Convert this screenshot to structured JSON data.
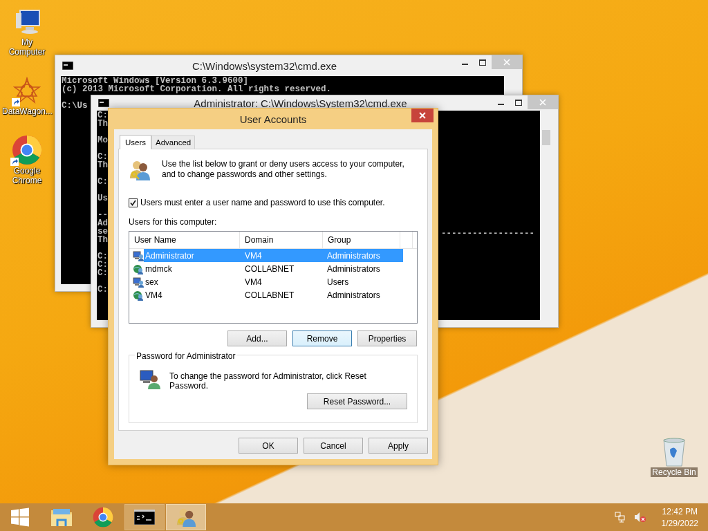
{
  "desktop_icons": [
    {
      "label": "My Computer",
      "kind": "computer",
      "shortcut": false
    },
    {
      "label": "DataWagon...",
      "kind": "star",
      "shortcut": true
    },
    {
      "label": "Google Chrome",
      "kind": "chrome",
      "shortcut": true
    }
  ],
  "recycle_bin": {
    "label": "Recycle Bin"
  },
  "back_console": {
    "title": "C:\\Windows\\system32\\cmd.exe",
    "blocks": [
      [
        "Microsoft Windows [Version 6.3.9600]",
        "(c) 2013 Microsoft Corporation. All rights reserved."
      ],
      [
        "C:\\Us"
      ]
    ]
  },
  "admin_console": {
    "title": "Administrator: C:\\Windows\\System32\\cmd.exe",
    "blocks": [
      [
        "C:",
        "Th"
      ],
      [
        "Mo"
      ],
      [
        "C:",
        "Th"
      ],
      [
        "C:"
      ],
      [
        "Us"
      ],
      [
        "--",
        "Ad",
        "se",
        "Th"
      ],
      [
        "C:",
        "C:",
        "C:"
      ],
      [
        "C:"
      ]
    ],
    "right_line": "------------------"
  },
  "dialog": {
    "title": "User Accounts",
    "tabs": [
      {
        "label": "Users",
        "selected": true
      },
      {
        "label": "Advanced",
        "selected": false
      }
    ],
    "intro": "Use the list below to grant or deny users access to your computer, and to change passwords and other settings.",
    "require_password": {
      "label": "Users must enter a user name and password to use this computer.",
      "checked": true
    },
    "list_label": "Users for this computer:",
    "columns": [
      "User Name",
      "Domain",
      "Group"
    ],
    "rows": [
      {
        "kind": "local",
        "name": "Administrator",
        "domain": "VM4",
        "group": "Administrators",
        "selected": true
      },
      {
        "kind": "domain",
        "name": "mdmck",
        "domain": "COLLABNET",
        "group": "Administrators",
        "selected": false
      },
      {
        "kind": "local",
        "name": "sex",
        "domain": "VM4",
        "group": "Users",
        "selected": false
      },
      {
        "kind": "domain",
        "name": "VM4",
        "domain": "COLLABNET",
        "group": "Administrators",
        "selected": false
      }
    ],
    "list_buttons": [
      {
        "label": "Add...",
        "focused": false
      },
      {
        "label": "Remove",
        "focused": true
      },
      {
        "label": "Properties",
        "focused": false
      }
    ],
    "password_group": {
      "title": "Password for Administrator",
      "text": "To change the password for Administrator, click Reset Password.",
      "button": "Reset Password..."
    },
    "buttons": [
      "OK",
      "Cancel",
      "Apply"
    ]
  },
  "taskbar": {
    "items": [
      {
        "kind": "start",
        "running": false,
        "selected": false
      },
      {
        "kind": "folder",
        "running": false,
        "selected": false
      },
      {
        "kind": "chrome",
        "running": false,
        "selected": false
      },
      {
        "kind": "console",
        "running": true,
        "selected": false
      },
      {
        "kind": "users",
        "running": true,
        "selected": true
      }
    ],
    "time": "12:42 PM",
    "date": "1/29/2022"
  }
}
